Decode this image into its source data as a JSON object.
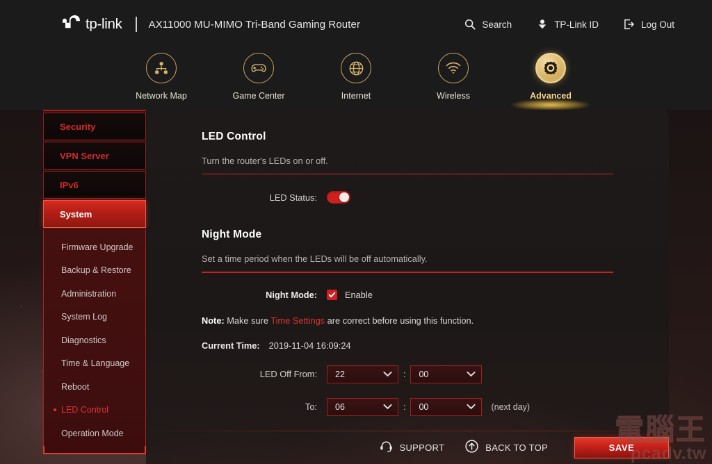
{
  "header": {
    "brand": "tp-link",
    "brand_icon": "tplink-logo-icon",
    "model": "AX11000 MU-MIMO Tri-Band Gaming Router",
    "actions": [
      {
        "label": "Search",
        "icon": "search-icon"
      },
      {
        "label": "TP-Link ID",
        "icon": "user-icon"
      },
      {
        "label": "Log Out",
        "icon": "logout-icon"
      }
    ]
  },
  "tabs": [
    {
      "label": "Network Map",
      "icon": "network-map-icon",
      "active": false
    },
    {
      "label": "Game Center",
      "icon": "gamepad-icon",
      "active": false
    },
    {
      "label": "Internet",
      "icon": "globe-icon",
      "active": false
    },
    {
      "label": "Wireless",
      "icon": "wifi-icon",
      "active": false
    },
    {
      "label": "Advanced",
      "icon": "gear-icon",
      "active": true
    }
  ],
  "sidebar": {
    "items": [
      {
        "label": "Security",
        "active": false
      },
      {
        "label": "VPN Server",
        "active": false
      },
      {
        "label": "IPv6",
        "active": false
      },
      {
        "label": "System",
        "active": true
      }
    ],
    "sub_items": [
      {
        "label": "Firmware Upgrade",
        "active": false
      },
      {
        "label": "Backup & Restore",
        "active": false
      },
      {
        "label": "Administration",
        "active": false
      },
      {
        "label": "System Log",
        "active": false
      },
      {
        "label": "Diagnostics",
        "active": false
      },
      {
        "label": "Time & Language",
        "active": false
      },
      {
        "label": "Reboot",
        "active": false
      },
      {
        "label": "LED Control",
        "active": true
      },
      {
        "label": "Operation Mode",
        "active": false
      }
    ]
  },
  "led_control": {
    "title": "LED Control",
    "subtitle": "Turn the router's LEDs on or off.",
    "status_label": "LED Status:",
    "status_on": true
  },
  "night_mode": {
    "title": "Night Mode",
    "subtitle": "Set a time period when the LEDs will be off automatically.",
    "enable_label": "Night Mode:",
    "enable_text": "Enable",
    "enabled": true,
    "note_prefix": "Note:",
    "note_text_1": " Make sure ",
    "note_link": "Time Settings",
    "note_text_2": " are correct before using this function.",
    "current_time_label": "Current Time:",
    "current_time_value": "2019-11-04 16:09:24",
    "from_label": "LED Off From:",
    "from_hour": "22",
    "from_minute": "00",
    "to_label": "To:",
    "to_hour": "06",
    "to_minute": "00",
    "next_day": "(next day)",
    "time_separator": ":"
  },
  "footer": {
    "support_label": "SUPPORT",
    "support_icon": "headset-icon",
    "back_to_top_label": "BACK TO TOP",
    "back_to_top_icon": "arrow-up-circle-icon",
    "save_label": "SAVE"
  },
  "watermark": {
    "chinese": "電腦王",
    "latin": "pcadv.tw"
  },
  "colors": {
    "accent_red": "#cf1f1f",
    "accent_gold": "#f3d48a",
    "panel_bg": "#1e1a1a",
    "header_bg": "#1b1b1b"
  }
}
